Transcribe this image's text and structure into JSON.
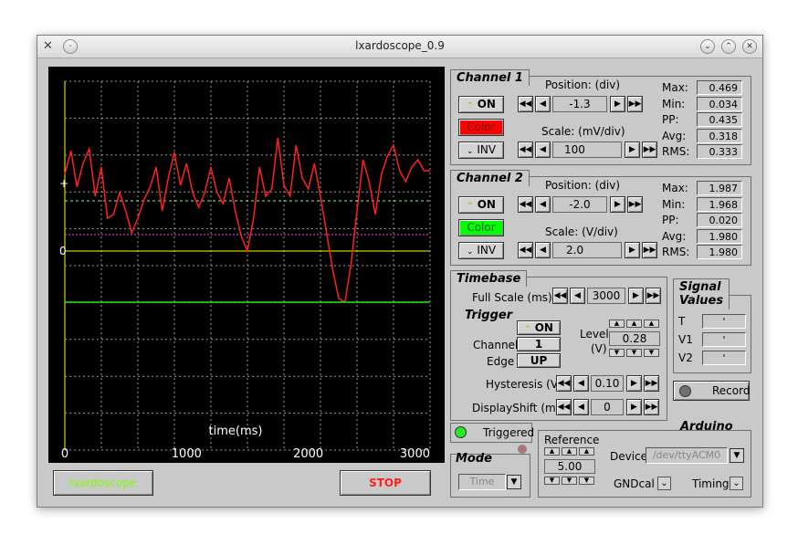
{
  "window": {
    "title": "lxardoscope_0.9"
  },
  "chart_data": {
    "type": "line",
    "xlabel": "time(ms)",
    "x_ticks": [
      "0",
      "1000",
      "2000",
      "3000"
    ],
    "y_labels": [
      "+",
      "0"
    ],
    "xlim": [
      0,
      3000
    ],
    "background": "#000000",
    "series": [
      {
        "color": "#ff2020",
        "x": [
          0,
          50,
          100,
          150,
          200,
          250,
          300,
          350,
          400,
          450,
          500,
          550,
          600,
          650,
          700,
          750,
          800,
          850,
          900,
          950,
          1000,
          1050,
          1100,
          1150,
          1200,
          1250,
          1300,
          1350,
          1400,
          1450,
          1500,
          1550,
          1600,
          1650,
          1700,
          1750,
          1800,
          1850,
          1900,
          1950,
          2000,
          2050,
          2100,
          2150,
          2200,
          2250,
          2300,
          2350,
          2400,
          2450,
          2500,
          2550,
          2600,
          2650,
          2700,
          2750,
          2800,
          2850,
          2900,
          2950,
          3000
        ],
        "y": [
          0.42,
          0.55,
          0.35,
          0.48,
          0.56,
          0.3,
          0.46,
          0.18,
          0.2,
          0.32,
          0.22,
          0.1,
          0.18,
          0.28,
          0.35,
          0.46,
          0.22,
          0.4,
          0.54,
          0.36,
          0.48,
          0.32,
          0.24,
          0.32,
          0.46,
          0.32,
          0.26,
          0.4,
          0.22,
          0.08,
          0.0,
          0.18,
          0.46,
          0.3,
          0.34,
          0.62,
          0.36,
          0.3,
          0.58,
          0.4,
          0.34,
          0.48,
          0.3,
          0.1,
          -0.1,
          -0.26,
          -0.28,
          -0.08,
          0.22,
          0.5,
          0.38,
          0.2,
          0.42,
          0.52,
          0.58,
          0.44,
          0.38,
          0.46,
          0.5,
          0.44,
          0.44
        ]
      },
      {
        "color": "#20e020",
        "x": [
          0,
          500,
          1000,
          1500,
          2000,
          2500,
          3000
        ],
        "y": [
          -0.28,
          -0.28,
          -0.28,
          -0.28,
          -0.28,
          -0.28,
          -0.28
        ]
      }
    ]
  },
  "bottom": {
    "app_button": "lxardoscope",
    "stop_button": "STOP"
  },
  "channel1": {
    "title": "Channel 1",
    "position_label": "Position: (div)",
    "position_value": "-1.3",
    "scale_label": "Scale: (mV/div)",
    "scale_value": "100",
    "on_label": "ON",
    "color_label": "Color",
    "color": "#ff0000",
    "inv_label": "INV",
    "stats": [
      {
        "label": "Max:",
        "value": "0.469"
      },
      {
        "label": "Min:",
        "value": "0.034"
      },
      {
        "label": "PP:",
        "value": "0.435"
      },
      {
        "label": "Avg:",
        "value": "0.318"
      },
      {
        "label": "RMS:",
        "value": "0.333"
      }
    ]
  },
  "channel2": {
    "title": "Channel 2",
    "position_label": "Position: (div)",
    "position_value": "-2.0",
    "scale_label": "Scale: (V/div)",
    "scale_value": "2.0",
    "on_label": "ON",
    "color_label": "Color",
    "color": "#00ff00",
    "inv_label": "INV",
    "stats": [
      {
        "label": "Max:",
        "value": "1.987"
      },
      {
        "label": "Min:",
        "value": "1.968"
      },
      {
        "label": "PP:",
        "value": "0.020"
      },
      {
        "label": "Avg:",
        "value": "1.980"
      },
      {
        "label": "RMS:",
        "value": "1.980"
      }
    ]
  },
  "timebase": {
    "title": "Timebase",
    "full_scale_label": "Full Scale (ms)",
    "full_scale_value": "3000"
  },
  "trigger": {
    "title": "Trigger",
    "on_label": "ON",
    "channel_label": "Channel",
    "channel_value": "1",
    "edge_label": "Edge",
    "edge_value": "UP",
    "level_label": "Level",
    "level_unit": "(V)",
    "level_value": "0.28",
    "hysteresis_label": "Hysteresis (V)",
    "hysteresis_value": "0.10",
    "displayshift_label": "DisplayShift (ms)",
    "displayshift_value": "0"
  },
  "triggered": {
    "label": "Triggered"
  },
  "signal_values": {
    "title_line1": "Signal",
    "title_line2": "Values",
    "rows": [
      {
        "label": "T",
        "value": "'"
      },
      {
        "label": "V1",
        "value": "'"
      },
      {
        "label": "V2",
        "value": "'"
      }
    ]
  },
  "record": {
    "label": "Record"
  },
  "mode": {
    "title": "Mode",
    "value": "Time"
  },
  "arduino": {
    "title": "Arduino",
    "reference_label": "Reference",
    "reference_value": "5.00",
    "device_label": "Device",
    "device_value": "/dev/ttyACM0",
    "gndcal_label": "GNDcal",
    "timing_label": "Timing"
  }
}
